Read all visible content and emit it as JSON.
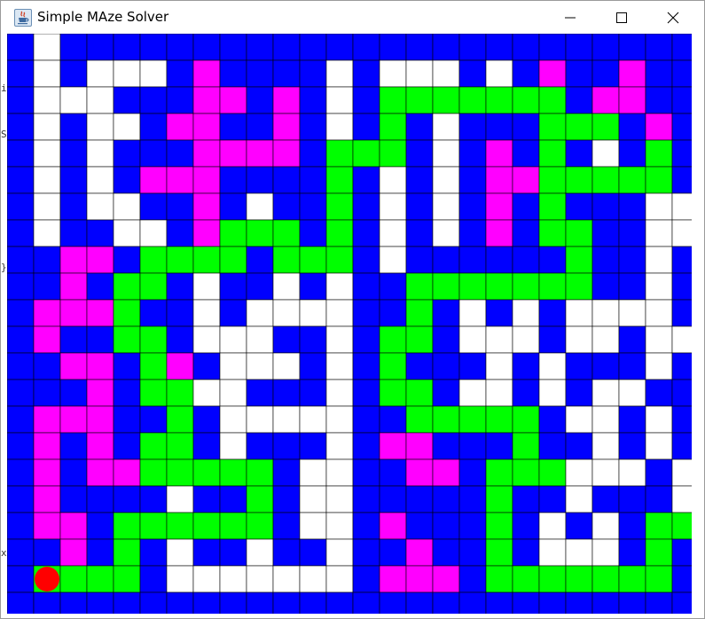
{
  "window": {
    "title": "Simple MAze Solver"
  },
  "icons": {
    "app": "java-coffee-icon",
    "minimize": "minimize-icon",
    "maximize": "maximize-icon",
    "close": "close-icon"
  },
  "colors": {
    "wall": "#0000ff",
    "open": "#ffffff",
    "path": "#00ff00",
    "visited": "#ff00ff",
    "start": "#ff0000",
    "grid": "#000000"
  },
  "maze": {
    "legend": "W = wall, O = open, G = solution path, M = visited dead-end, S = start marker",
    "rows": [
      "WOWWWWWWWWWWWWWWWWWWWWWWWWW",
      "WOWOOOWMWWWWOWOOOWOWMWWMWWW",
      "WOOOWWWMMWMWOWGGGGGGGWMMWWW",
      "WOWOOWMMWWMWOWGWOWWWGGGWMWW",
      "WOWOWWWMMMMWGGGWOWMWGWOWGWW",
      "WOWOWMMMWWWWGWOWOWMMGGGGGWW",
      "WOWOOWWMWOWWGWOWOWMWGWWWOOW",
      "WOWWOOWMGGGWGWOWOWMWGGWWOOW",
      "WWMMWGGGGWGGGWOWWWWWWGWWOWW",
      "WWMWGGWOWWOWOWWGGGGGGGWWOWW",
      "WMMMGWWOWOOOOWWGWOWOWOOOOWW",
      "WMWWGGWOOOWWOWGGWOOOWOOWOOW",
      "WWMMWGMWOOOWOWGWWWOWOWWWOWW",
      "WWWMWGGOOWWWOWGGWOOWOWOOWWW",
      "WMMMWWGWOOOOOWWGGGGGWOOWOWW",
      "WMWMWGGWOWWWOWMMWWWGWWOWOWW",
      "WMWMMGGGGGWOOWWMMWGGGOOOWOW",
      "WMWWWWOWWGWOOWWWWWGWWOWWWOW",
      "WMMWGGGGGGWOOWMWWWGWOWOWGGW",
      "WWMWGWOWWOWWOWWMWWGWOOOWGWW",
      "WSGGGWOOOOOOOWMMMWGGGGGGGWO",
      "WWWWWWWWWWWWWWWWWWWWWWWWWWW"
    ]
  },
  "edge_fragments": [
    "i",
    "S",
    "}",
    "x"
  ]
}
